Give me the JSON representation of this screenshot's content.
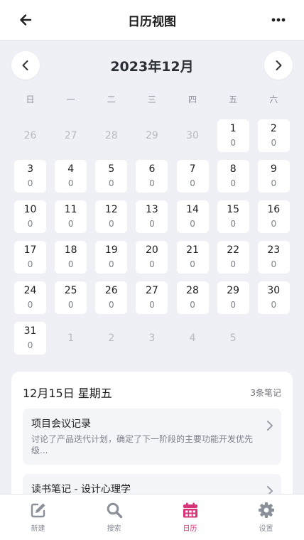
{
  "header": {
    "title": "日历视图",
    "back_icon": "arrow-left-icon",
    "more_icon": "ellipsis-icon"
  },
  "month_nav": {
    "label": "2023年12月",
    "prev_icon": "chevron-left-icon",
    "next_icon": "chevron-right-icon"
  },
  "weekdays": [
    "日",
    "一",
    "二",
    "三",
    "四",
    "五",
    "六"
  ],
  "calendar": {
    "days": [
      {
        "d": "26",
        "c": "",
        "cur": false
      },
      {
        "d": "27",
        "c": "",
        "cur": false
      },
      {
        "d": "28",
        "c": "",
        "cur": false
      },
      {
        "d": "29",
        "c": "",
        "cur": false
      },
      {
        "d": "30",
        "c": "",
        "cur": false
      },
      {
        "d": "1",
        "c": "0",
        "cur": true
      },
      {
        "d": "2",
        "c": "0",
        "cur": true
      },
      {
        "d": "3",
        "c": "0",
        "cur": true
      },
      {
        "d": "4",
        "c": "0",
        "cur": true
      },
      {
        "d": "5",
        "c": "0",
        "cur": true
      },
      {
        "d": "6",
        "c": "0",
        "cur": true
      },
      {
        "d": "7",
        "c": "0",
        "cur": true
      },
      {
        "d": "8",
        "c": "0",
        "cur": true
      },
      {
        "d": "9",
        "c": "0",
        "cur": true
      },
      {
        "d": "10",
        "c": "0",
        "cur": true
      },
      {
        "d": "11",
        "c": "0",
        "cur": true
      },
      {
        "d": "12",
        "c": "0",
        "cur": true
      },
      {
        "d": "13",
        "c": "0",
        "cur": true
      },
      {
        "d": "14",
        "c": "0",
        "cur": true
      },
      {
        "d": "15",
        "c": "0",
        "cur": true
      },
      {
        "d": "16",
        "c": "0",
        "cur": true
      },
      {
        "d": "17",
        "c": "0",
        "cur": true
      },
      {
        "d": "18",
        "c": "0",
        "cur": true
      },
      {
        "d": "19",
        "c": "0",
        "cur": true
      },
      {
        "d": "20",
        "c": "0",
        "cur": true
      },
      {
        "d": "21",
        "c": "0",
        "cur": true
      },
      {
        "d": "22",
        "c": "0",
        "cur": true
      },
      {
        "d": "23",
        "c": "0",
        "cur": true
      },
      {
        "d": "24",
        "c": "0",
        "cur": true
      },
      {
        "d": "25",
        "c": "0",
        "cur": true
      },
      {
        "d": "26",
        "c": "0",
        "cur": true
      },
      {
        "d": "27",
        "c": "0",
        "cur": true
      },
      {
        "d": "28",
        "c": "0",
        "cur": true
      },
      {
        "d": "29",
        "c": "0",
        "cur": true
      },
      {
        "d": "30",
        "c": "0",
        "cur": true
      },
      {
        "d": "31",
        "c": "0",
        "cur": true
      },
      {
        "d": "1",
        "c": "",
        "cur": false
      },
      {
        "d": "2",
        "c": "",
        "cur": false
      },
      {
        "d": "3",
        "c": "",
        "cur": false
      },
      {
        "d": "4",
        "c": "",
        "cur": false
      },
      {
        "d": "5",
        "c": "",
        "cur": false
      },
      {
        "d": "",
        "c": "",
        "cur": false
      }
    ]
  },
  "notes": {
    "date": "12月15日 星期五",
    "count": "3条笔记",
    "items": [
      {
        "title": "项目会议记录",
        "body": "讨论了产品迭代计划，确定了下一阶段的主要功能开发优先级..."
      },
      {
        "title": "读书笔记 - 设计心理学",
        "body": ""
      }
    ]
  },
  "tabbar": {
    "tabs": [
      {
        "label": "新建",
        "icon": "edit-icon"
      },
      {
        "label": "搜索",
        "icon": "search-icon"
      },
      {
        "label": "日历",
        "icon": "calendar-icon"
      },
      {
        "label": "设置",
        "icon": "gear-icon"
      }
    ],
    "active_color": "#d6337a",
    "inactive_color": "#8a8f99"
  }
}
